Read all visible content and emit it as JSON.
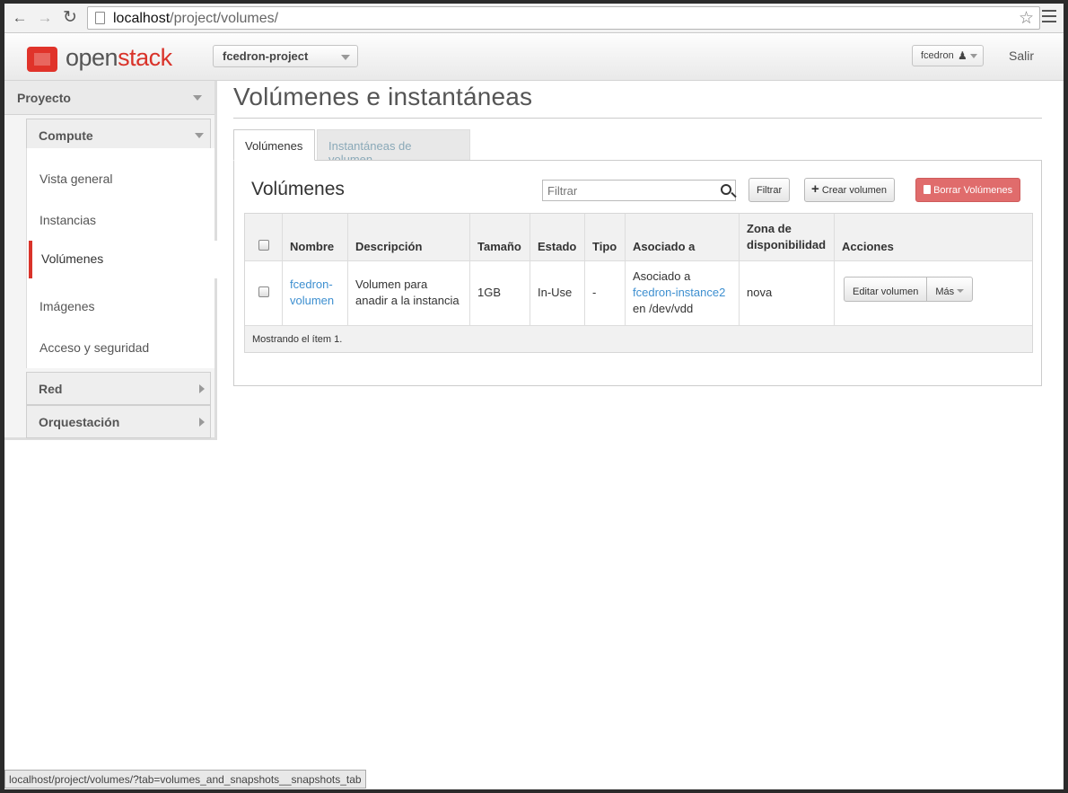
{
  "browser": {
    "url_host": "localhost",
    "url_path": "/project/volumes/",
    "status_url": "localhost/project/volumes/?tab=volumes_and_snapshots__snapshots_tab"
  },
  "header": {
    "brand_a": "open",
    "brand_b": "stack",
    "project_selector": "fcedron-project",
    "user_menu": "fcedron",
    "logout": "Salir"
  },
  "sidebar": {
    "dashboard": "Proyecto",
    "compute": "Compute",
    "items": [
      "Vista general",
      "Instancias",
      "Volúmenes",
      "Imágenes",
      "Acceso y seguridad"
    ],
    "network": "Red",
    "orchestration": "Orquestación"
  },
  "main": {
    "title": "Volúmenes e instantáneas",
    "tabs": [
      "Volúmenes",
      "Instantáneas de volumen"
    ],
    "panel_title": "Volúmenes",
    "filter_placeholder": "Filtrar",
    "filter_button": "Filtrar",
    "create_button": "Crear volumen",
    "delete_button": "Borrar Volúmenes",
    "columns": [
      "Nombre",
      "Descripción",
      "Tamaño",
      "Estado",
      "Tipo",
      "Asociado a",
      "Zona de disponibilidad",
      "Acciones"
    ],
    "rows": [
      {
        "name": "fcedron-volumen",
        "description": "Volumen para anadir a la instancia",
        "size": "1GB",
        "status": "In-Use",
        "type": "-",
        "attached_prefix": "Asociado a",
        "attached_link": "fcedron-instance2",
        "attached_suffix": "en /dev/vdd",
        "zone": "nova",
        "edit_action": "Editar volumen",
        "more_action": "Más"
      }
    ],
    "footer": "Mostrando el ítem 1."
  },
  "colors": {
    "brand_red": "#d9332a",
    "link_blue": "#3d8fd0",
    "danger_button": "#e06c6c"
  }
}
